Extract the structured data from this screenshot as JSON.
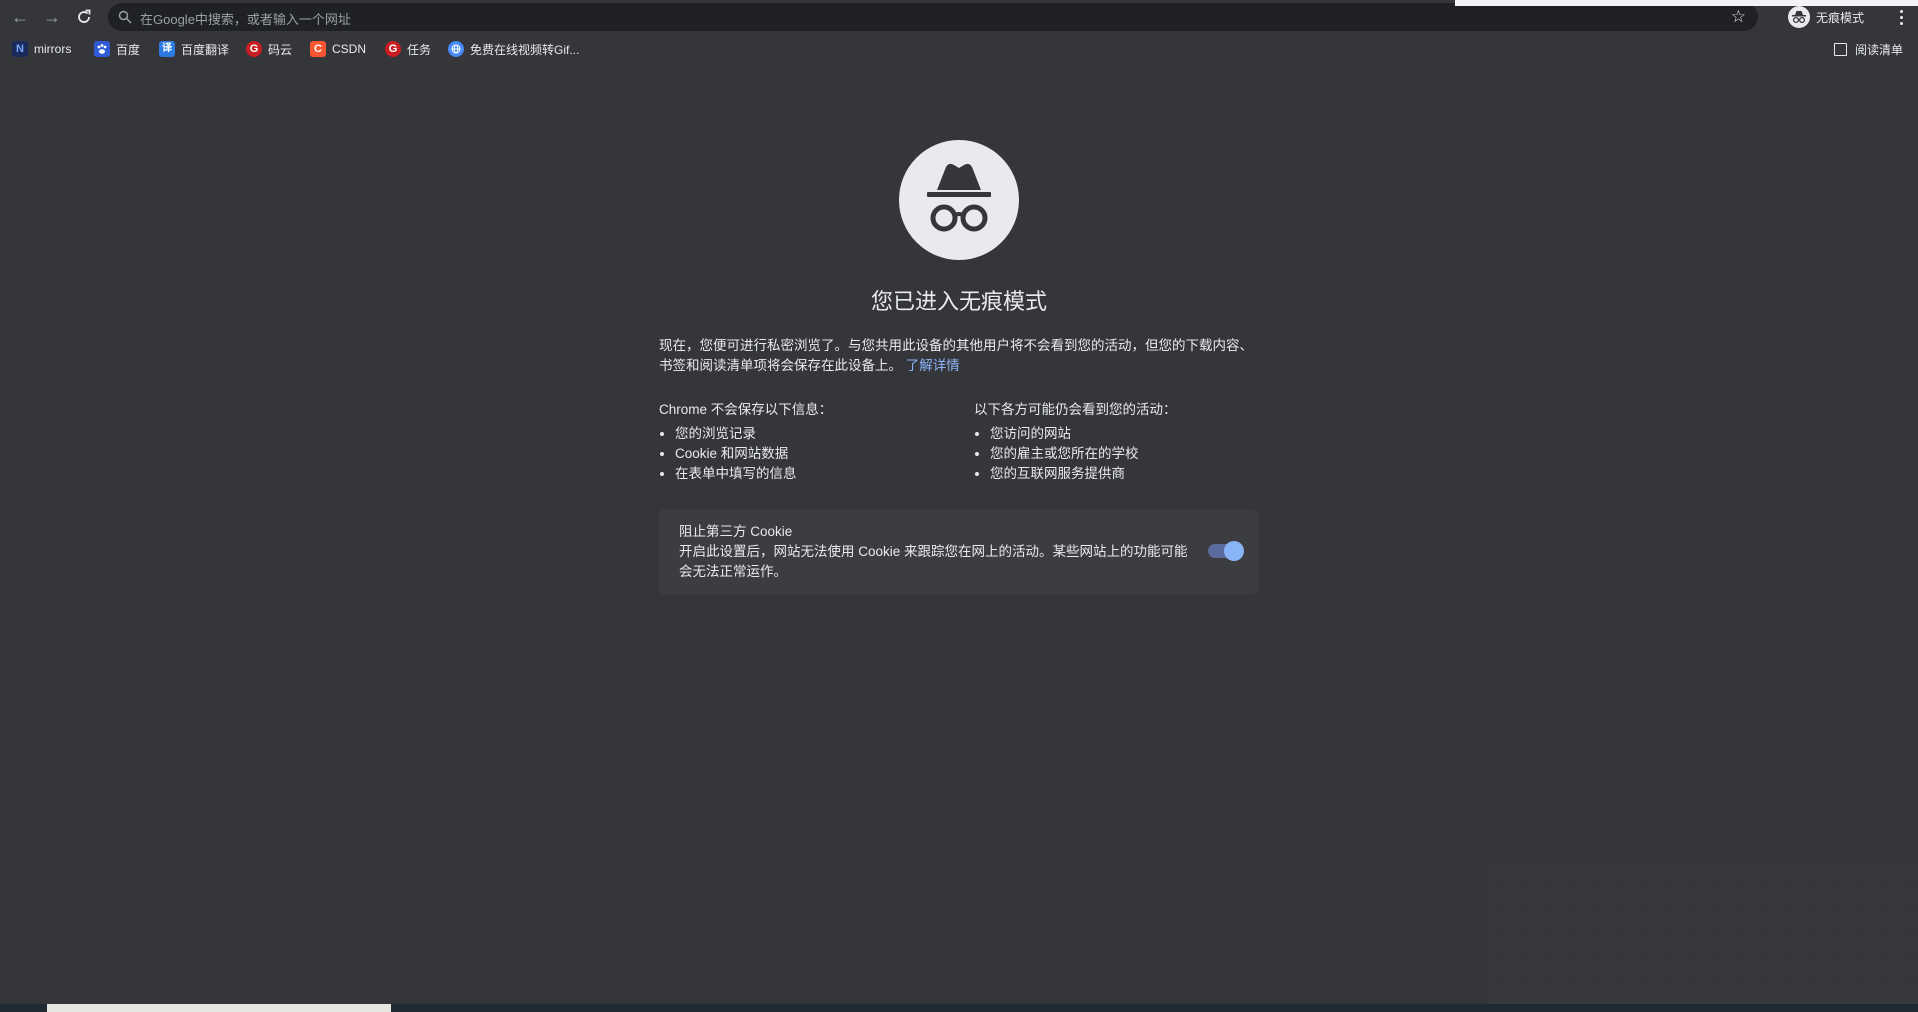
{
  "toolbar": {
    "omnibox_placeholder": "在Google中搜索，或者输入一个网址",
    "profile_label": "无痕模式"
  },
  "bookmarks": [
    {
      "label": "mirrors",
      "icon": "N",
      "icon_bg": "#1a2a5c"
    },
    {
      "label": "百度",
      "icon": "paw",
      "icon_bg": "#2f5bd6"
    },
    {
      "label": "百度翻译",
      "icon": "译",
      "icon_bg": "#2c7be5"
    },
    {
      "label": "码云",
      "icon": "G",
      "icon_bg": "#c71d23"
    },
    {
      "label": "CSDN",
      "icon": "C",
      "icon_bg": "#fc5531"
    },
    {
      "label": "任务",
      "icon": "G",
      "icon_bg": "#c71d23"
    },
    {
      "label": "免费在线视频转Gif...",
      "icon": "globe",
      "icon_bg": "#4a8af4"
    }
  ],
  "reading_list_label": "阅读清单",
  "content": {
    "title": "您已进入无痕模式",
    "intro": "现在，您便可进行私密浏览了。与您共用此设备的其他用户将不会看到您的活动，但您的下载内容、书签和阅读清单项将会保存在此设备上。",
    "learn_more": "了解详情",
    "left_heading": "Chrome 不会保存以下信息：",
    "left_items": [
      "您的浏览记录",
      "Cookie 和网站数据",
      "在表单中填写的信息"
    ],
    "right_heading": "以下各方可能仍会看到您的活动：",
    "right_items": [
      "您访问的网站",
      "您的雇主或您所在的学校",
      "您的互联网服务提供商"
    ],
    "cookie_title": "阻止第三方 Cookie",
    "cookie_desc": "开启此设置后，网站无法使用 Cookie 来跟踪您在网上的活动。某些网站上的功能可能会无法正常运作。",
    "cookie_toggle_on": true
  },
  "colors": {
    "background": "#35363a",
    "link": "#8ab4f8",
    "toggle_knob": "#8ab4f8"
  }
}
